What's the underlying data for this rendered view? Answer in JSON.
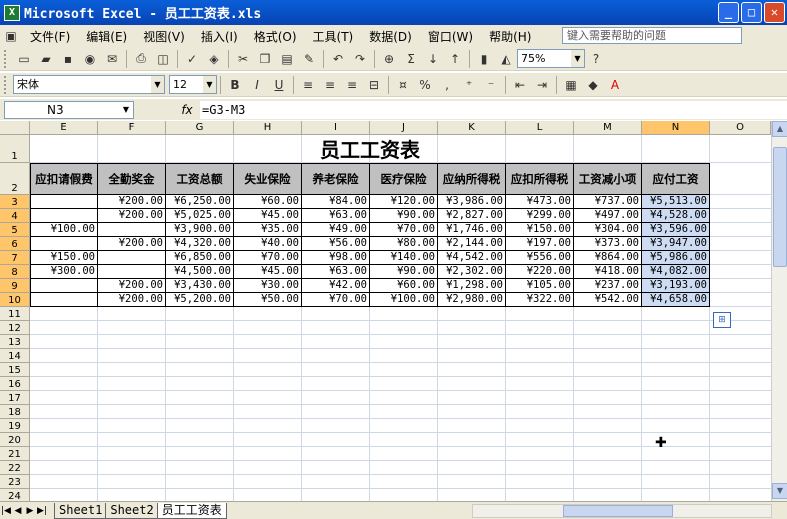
{
  "window": {
    "title": "Microsoft Excel - 员工工资表.xls",
    "app_icon": "excel-icon"
  },
  "menu": [
    "文件(F)",
    "编辑(E)",
    "视图(V)",
    "插入(I)",
    "格式(O)",
    "工具(T)",
    "数据(D)",
    "窗口(W)",
    "帮助(H)"
  ],
  "help_placeholder": "键入需要帮助的问题",
  "toolbar": {
    "zoom": "75%"
  },
  "format": {
    "font": "宋体",
    "size": "12",
    "bold": "B",
    "italic": "I",
    "underline": "U"
  },
  "formula_bar": {
    "cell_ref": "N3",
    "fx": "fx",
    "formula": "=G3-M3"
  },
  "columns": [
    "E",
    "F",
    "G",
    "H",
    "I",
    "J",
    "K",
    "L",
    "M",
    "N",
    "O"
  ],
  "sheet": {
    "title": "员工工资表",
    "headers": [
      "应扣请假费",
      "全勤奖金",
      "工资总额",
      "失业保险",
      "养老保险",
      "医疗保险",
      "应纳所得税",
      "应扣所得税",
      "工资减小项",
      "应付工资"
    ],
    "rows": [
      [
        "",
        "¥200.00",
        "¥6,250.00",
        "¥60.00",
        "¥84.00",
        "¥120.00",
        "¥3,986.00",
        "¥473.00",
        "¥737.00",
        "¥5,513.00"
      ],
      [
        "",
        "¥200.00",
        "¥5,025.00",
        "¥45.00",
        "¥63.00",
        "¥90.00",
        "¥2,827.00",
        "¥299.00",
        "¥497.00",
        "¥4,528.00"
      ],
      [
        "¥100.00",
        "",
        "¥3,900.00",
        "¥35.00",
        "¥49.00",
        "¥70.00",
        "¥1,746.00",
        "¥150.00",
        "¥304.00",
        "¥3,596.00"
      ],
      [
        "",
        "¥200.00",
        "¥4,320.00",
        "¥40.00",
        "¥56.00",
        "¥80.00",
        "¥2,144.00",
        "¥197.00",
        "¥373.00",
        "¥3,947.00"
      ],
      [
        "¥150.00",
        "",
        "¥6,850.00",
        "¥70.00",
        "¥98.00",
        "¥140.00",
        "¥4,542.00",
        "¥556.00",
        "¥864.00",
        "¥5,986.00"
      ],
      [
        "¥300.00",
        "",
        "¥4,500.00",
        "¥45.00",
        "¥63.00",
        "¥90.00",
        "¥2,302.00",
        "¥220.00",
        "¥418.00",
        "¥4,082.00"
      ],
      [
        "",
        "¥200.00",
        "¥3,430.00",
        "¥30.00",
        "¥42.00",
        "¥60.00",
        "¥1,298.00",
        "¥105.00",
        "¥237.00",
        "¥3,193.00"
      ],
      [
        "",
        "¥200.00",
        "¥5,200.00",
        "¥50.00",
        "¥70.00",
        "¥100.00",
        "¥2,980.00",
        "¥322.00",
        "¥542.00",
        "¥4,658.00"
      ]
    ]
  },
  "row_numbers": [
    "1",
    "2",
    "3",
    "4",
    "5",
    "6",
    "7",
    "8",
    "9",
    "10",
    "11",
    "12",
    "13",
    "14",
    "15",
    "16",
    "17",
    "18",
    "19",
    "20",
    "21",
    "22",
    "23",
    "24"
  ],
  "sheets": [
    "Sheet1",
    "Sheet2",
    "员工工资表"
  ],
  "active_sheet": "员工工资表"
}
